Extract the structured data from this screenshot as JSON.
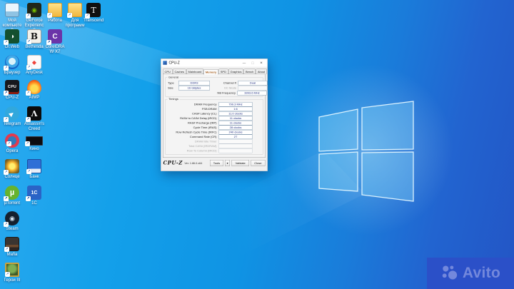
{
  "wallpaper": {
    "style": "windows10-light-blue",
    "colors": {
      "sky": "#0f93e4",
      "right_shade": "#2355c5",
      "logo_edge": "#d9f2fd",
      "glow": "#ffffff"
    }
  },
  "desktop": {
    "icons": [
      {
        "name": "my-computer",
        "label": "Мой компьютер"
      },
      {
        "name": "geforce-experience",
        "label": "GeForce Experience"
      },
      {
        "name": "folder-work",
        "label": "Работа"
      },
      {
        "name": "folder-programs",
        "label": "Для программ"
      },
      {
        "name": "transcend",
        "label": "Transcend"
      },
      {
        "name": "drweb",
        "label": "Dr.Web"
      },
      {
        "name": "bethesda",
        "label": "Bethesda"
      },
      {
        "name": "coreldraw",
        "label": "CorelDRAW X7"
      },
      {
        "name": "browser",
        "label": "Браузер"
      },
      {
        "name": "anydesk",
        "label": "AnyDesk"
      },
      {
        "name": "cpuz-shortcut",
        "label": "CPU-Z"
      },
      {
        "name": "aimp",
        "label": "AIMP"
      },
      {
        "name": "telegram",
        "label": "Telegram"
      },
      {
        "name": "assassins-creed",
        "label": "Assassin's Creed"
      },
      {
        "name": "opera",
        "label": "Opera"
      },
      {
        "name": "kino",
        "label": "Кино"
      },
      {
        "name": "sun-picture",
        "label": "Солнце"
      },
      {
        "name": "bank",
        "label": "Банк"
      },
      {
        "name": "utorrent",
        "label": "µTorrent"
      },
      {
        "name": "onec",
        "label": "1С"
      },
      {
        "name": "steam",
        "label": "Steam"
      },
      {
        "name": "mafia",
        "label": "Mafia"
      },
      {
        "name": "heroes",
        "label": "Герои III"
      }
    ]
  },
  "icons": {
    "geforce": "◉",
    "transcend": "T",
    "drweb": "◑",
    "bethesda": "B",
    "coreldraw": "C",
    "anydesk": "◆",
    "cpuz_app": "CPU",
    "telegram": "▶",
    "assassins": "Λ",
    "utorrent": "µ",
    "onec": "1С",
    "steam": "◉",
    "minimize": "—",
    "maximize": "▢",
    "close": "✕",
    "dropdown": "▾"
  },
  "cpuz": {
    "window": {
      "title": "CPU-Z"
    },
    "tabs": [
      "CPU",
      "Caches",
      "Mainboard",
      "Memory",
      "SPD",
      "Graphics",
      "Bench",
      "About"
    ],
    "active_tab": "Memory",
    "general": {
      "label": "General",
      "type_label": "Type",
      "type_value": "DDR3",
      "size_label": "Size",
      "size_value": "16 GBytes",
      "channel_label": "Channel #",
      "channel_value": "Dual",
      "dc_label": "DC Mode",
      "dc_value": "",
      "nb_label": "NB Frequency",
      "nb_value": "3393.6 MHz"
    },
    "timings": {
      "label": "Timings",
      "rows": [
        {
          "label": "DRAM Frequency",
          "value": "799.3 MHz"
        },
        {
          "label": "FSB:DRAM",
          "value": "1:6"
        },
        {
          "label": "CAS# Latency (CL)",
          "value": "11.0 clocks"
        },
        {
          "label": "RAS# to CAS# Delay (tRCD)",
          "value": "11 clocks"
        },
        {
          "label": "RAS# Precharge (tRP)",
          "value": "11 clocks"
        },
        {
          "label": "Cycle Time (tRAS)",
          "value": "28 clocks"
        },
        {
          "label": "Row Refresh Cycle Time (tRFC)",
          "value": "240 clocks"
        },
        {
          "label": "Command Rate (CR)",
          "value": "2T"
        },
        {
          "label": "DRAM Idle Timer",
          "value": ""
        },
        {
          "label": "Total CAS# (tRDRAM)",
          "value": ""
        },
        {
          "label": "Row To Column (tRCD)",
          "value": ""
        }
      ]
    },
    "footer": {
      "logo": "CPU-Z",
      "version": "Ver. 1.86.0.x64",
      "tools_label": "Tools",
      "validate_label": "Validate",
      "close_label": "Close"
    }
  },
  "watermark": {
    "text": "Avito",
    "bg": "#2b50c8",
    "fg": "#7388dc"
  }
}
